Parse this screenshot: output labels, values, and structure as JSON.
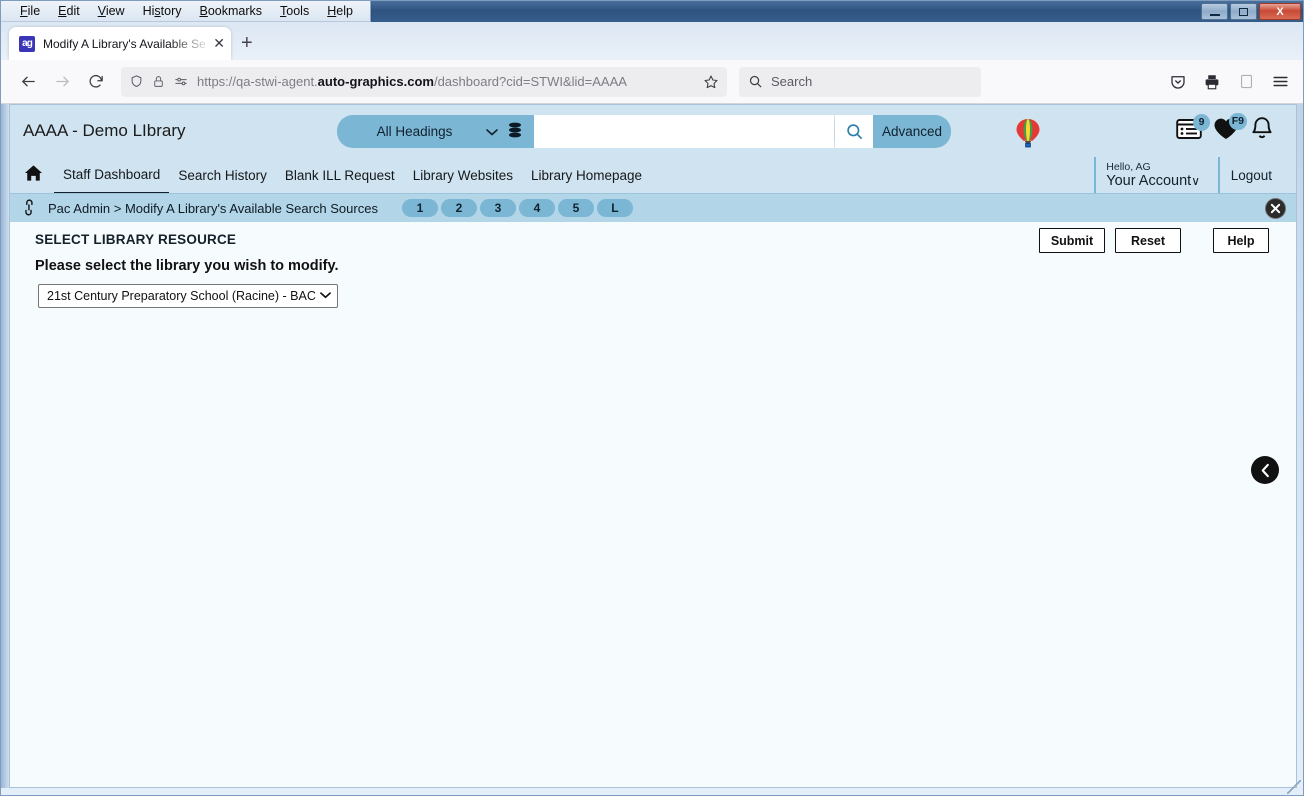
{
  "window": {
    "menu": [
      "File",
      "Edit",
      "View",
      "History",
      "Bookmarks",
      "Tools",
      "Help"
    ],
    "minimize_label": "Minimize",
    "maximize_label": "Maximize",
    "close_label": "X"
  },
  "browser": {
    "tab": {
      "title": "Modify A Library's Available Sea",
      "favicon_name": "page-favicon",
      "close_label": "✕"
    },
    "new_tab_label": "+",
    "back_label": "←",
    "forward_label": "→",
    "reload_label": "⟳",
    "url_prefix": "https://qa-stwi-agent.",
    "url_domain": "auto-graphics.com",
    "url_suffix": "/dashboard?cid=STWI&lid=AAAA",
    "bookmark_label": "☆",
    "search_placeholder": "Search",
    "toolbar_icons": [
      "save-to-pocket-icon",
      "print-icon",
      "reader-view-icon",
      "app-menu-icon"
    ]
  },
  "app": {
    "library_title": "AAAA - Demo LIbrary",
    "search": {
      "scope": "All Headings",
      "query": "",
      "database_icon": "database-icon",
      "magnifier_label": "⌕",
      "advanced_label": "Advanced"
    },
    "balloon_icon": "hot-air-balloon-icon",
    "header_icons": [
      {
        "name": "my-list-icon",
        "glyph": "▤",
        "badge": "9"
      },
      {
        "name": "favorites-heart-icon",
        "glyph": "♥",
        "badge": "F9"
      },
      {
        "name": "notifications-bell-icon",
        "glyph": "␇",
        "badge": ""
      }
    ],
    "nav": {
      "home_icon": "home-icon",
      "links": [
        {
          "label": "Staff Dashboard",
          "active": true
        },
        {
          "label": "Search History",
          "active": false
        },
        {
          "label": "Blank ILL Request",
          "active": false
        },
        {
          "label": "Library Websites",
          "active": false
        },
        {
          "label": "Library Homepage",
          "active": false
        }
      ],
      "hello": "Hello, AG",
      "your_account": "Your Account",
      "account_caret": "∨",
      "logout": "Logout"
    },
    "breadcrumb": {
      "icon": "link-chain-icon",
      "text": "Pac Admin > Modify A Library's Available Search Sources",
      "steps": [
        "1",
        "2",
        "3",
        "4",
        "5",
        "L"
      ],
      "close_label": "✕"
    },
    "form": {
      "section_title": "SELECT LIBRARY RESOURCE",
      "prompt": "Please select the library you wish to modify.",
      "library_select_value": "21st Century Preparatory School (Racine) - BAC",
      "library_select_caret": "⌄",
      "buttons": [
        {
          "name": "submit-button",
          "label": "Submit"
        },
        {
          "name": "reset-button",
          "label": "Reset"
        },
        {
          "name": "help-button",
          "label": "Help"
        }
      ],
      "back_arrow_label": "‹"
    }
  },
  "colors": {
    "header_blue": "#cfe4f0",
    "accent_blue": "#7bb6d4",
    "crumb_blue": "#b2d5e8",
    "content_bg": "#f6fbfe"
  }
}
